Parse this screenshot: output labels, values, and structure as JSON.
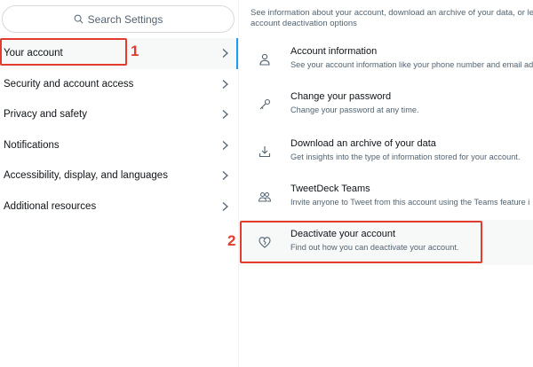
{
  "search": {
    "placeholder": "Search Settings"
  },
  "menu": [
    {
      "label": "Your account",
      "active": true
    },
    {
      "label": "Security and account access"
    },
    {
      "label": "Privacy and safety"
    },
    {
      "label": "Notifications"
    },
    {
      "label": "Accessibility, display, and languages"
    },
    {
      "label": "Additional resources"
    }
  ],
  "annotations": {
    "step1": "1",
    "step2": "2",
    "color": "#e33b2e"
  },
  "account": {
    "intro_line1": "See information about your account, download an archive of your data, or lea",
    "intro_line2": "account deactivation options",
    "items": [
      {
        "title": "Account information",
        "subtitle": "See your account information like your phone number and email add",
        "icon": "person-icon"
      },
      {
        "title": "Change your password",
        "subtitle": "Change your password at any time.",
        "icon": "key-icon"
      },
      {
        "title": "Download an archive of your data",
        "subtitle": "Get insights into the type of information stored for your account.",
        "icon": "download-icon"
      },
      {
        "title": "TweetDeck Teams",
        "subtitle": "Invite anyone to Tweet from this account using the Teams feature i",
        "icon": "people-icon"
      },
      {
        "title": "Deactivate your account",
        "subtitle": "Find out how you can deactivate your account.",
        "icon": "broken-heart-icon"
      }
    ]
  },
  "colors": {
    "accent": "#1d9bf0",
    "text": "#0f1419",
    "muted": "#536471",
    "hover_bg": "#f7f9f9"
  }
}
